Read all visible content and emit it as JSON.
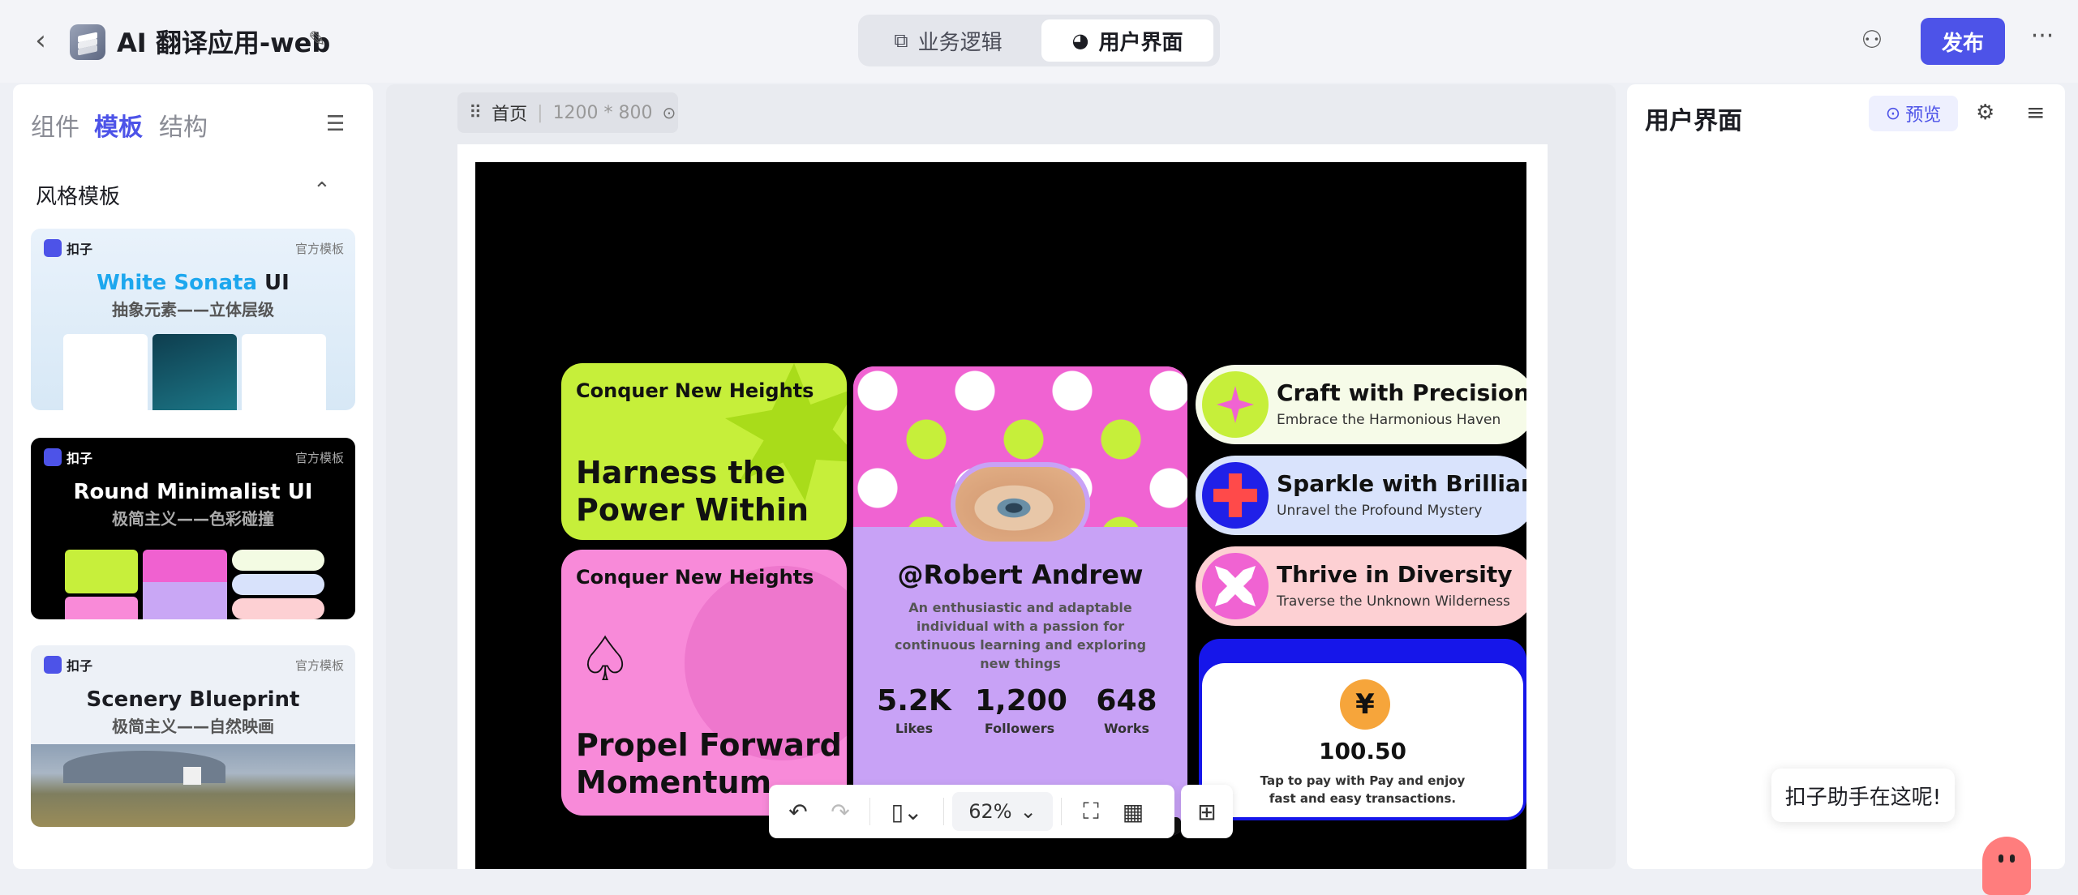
{
  "header": {
    "app_title": "AI 翻译应用-web",
    "mode_tabs": [
      {
        "label": "业务逻辑",
        "icon": "logic-icon"
      },
      {
        "label": "用户界面",
        "icon": "palette-icon"
      }
    ],
    "publish_label": "发布"
  },
  "left_panel": {
    "tabs": [
      "组件",
      "模板",
      "结构"
    ],
    "active_tab": "模板",
    "section_title": "风格模板",
    "templates": [
      {
        "brand": "扣子",
        "tag": "官方模板",
        "title_part1": "White Sonata",
        "title_part2": " UI",
        "subtitle": "抽象元素——立体层级"
      },
      {
        "brand": "扣子",
        "tag": "官方模板",
        "title": "Round Minimalist UI",
        "subtitle": "极简主义——色彩碰撞"
      },
      {
        "brand": "扣子",
        "tag": "官方模板",
        "title": "Scenery Blueprint",
        "subtitle": "极简主义——自然映画"
      }
    ]
  },
  "canvas": {
    "page_name": "首页",
    "page_size": "1200 * 800",
    "zoom": "62%",
    "content": {
      "green_card": {
        "kicker": "Conquer New Heights",
        "title_line1": "Harness the",
        "title_line2": "Power Within"
      },
      "pink_card": {
        "kicker": "Conquer New Heights",
        "title_line1": "Propel Forward",
        "title_line2": "Momentum"
      },
      "profile": {
        "handle": "@Robert Andrew",
        "bio": "An enthusiastic and adaptable individual with a passion for continuous learning and exploring new things",
        "stats": [
          {
            "value": "5.2K",
            "label": "Likes"
          },
          {
            "value": "1,200",
            "label": "Followers"
          },
          {
            "value": "648",
            "label": "Works"
          }
        ]
      },
      "pills": [
        {
          "title": "Craft with Precision",
          "subtitle": "Embrace the Harmonious Haven"
        },
        {
          "title": "Sparkle with Brilliance",
          "subtitle": "Unravel the Profound Mystery"
        },
        {
          "title": "Thrive in Diversity",
          "subtitle": "Traverse the Unknown Wilderness"
        }
      ],
      "payment": {
        "currency_symbol": "¥",
        "amount": "100.50",
        "description": "Tap to pay with Pay and enjoy fast and easy transactions."
      }
    }
  },
  "right_panel": {
    "title": "用户界面",
    "preview_label": "预览"
  },
  "assistant": {
    "bubble_text": "扣子助手在这呢!"
  },
  "colors": {
    "accent": "#4d53e8",
    "lime": "#c6ef3a",
    "pink": "#f88ad9",
    "lavender": "#c8a2f6",
    "blue": "#1616ea"
  }
}
